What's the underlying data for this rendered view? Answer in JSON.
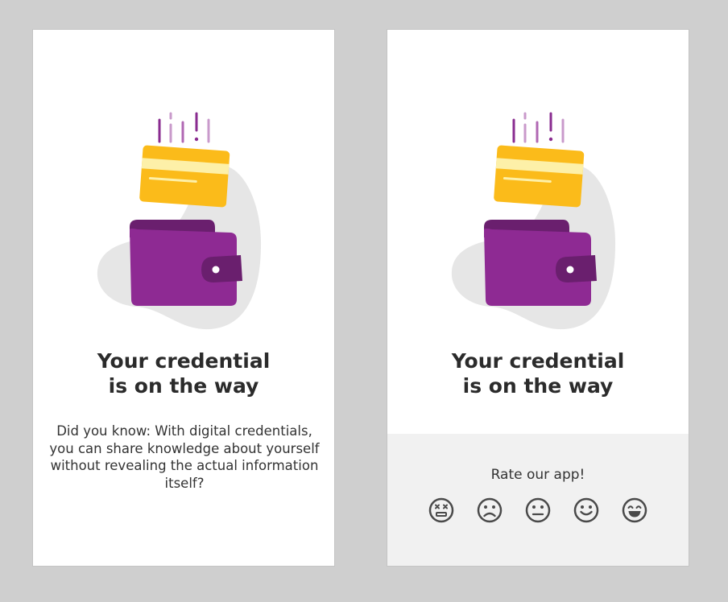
{
  "colors": {
    "background": "#cfcfcf",
    "card_yellow": "#fbbb1a",
    "card_stripe": "#fdf0a8",
    "wallet_purple": "#8e2a93",
    "wallet_dark": "#6a1f6e",
    "blob_gray": "#e6e6e6",
    "rating_panel": "#f1f1f1",
    "face_icon": "#4a4a4a"
  },
  "screens": [
    {
      "title_line1": "Your credential",
      "title_line2": "is on the way",
      "did_you_know": "Did you know: With digital credentials, you can share knowledge about yourself without revealing the actual information itself?"
    },
    {
      "title_line1": "Your credential",
      "title_line2": "is on the way",
      "rating": {
        "prompt": "Rate our app!",
        "faces": [
          "dead-face-icon",
          "sad-face-icon",
          "neutral-face-icon",
          "smile-face-icon",
          "laughing-face-icon"
        ]
      }
    }
  ]
}
